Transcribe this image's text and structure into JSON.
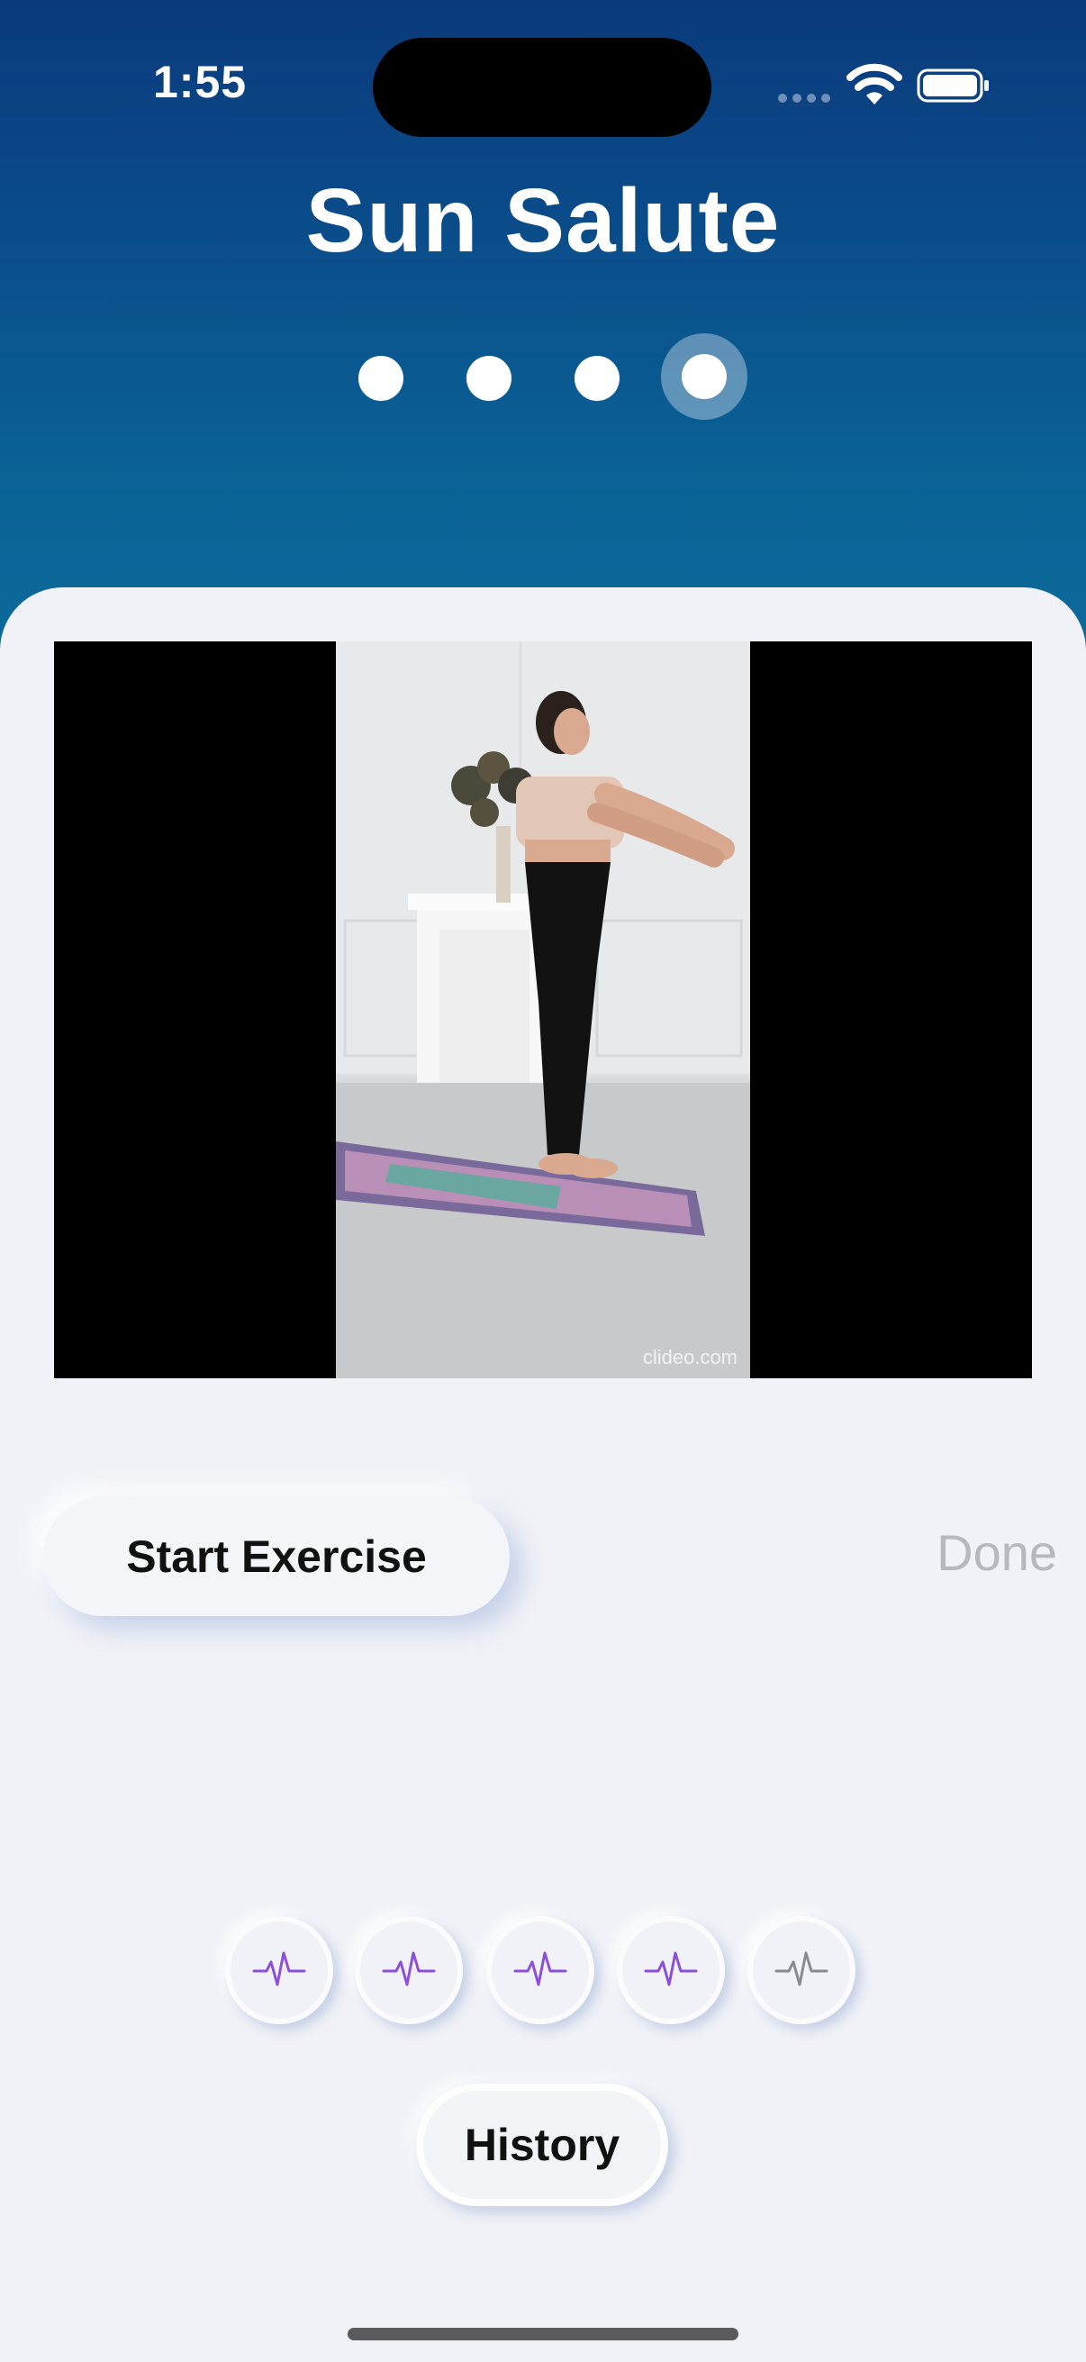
{
  "status_bar": {
    "time": "1:55"
  },
  "title": "Sun Salute",
  "page_indicator": {
    "count": 4,
    "active_index": 3
  },
  "video": {
    "watermark": "clideo.com"
  },
  "buttons": {
    "start": "Start Exercise",
    "done": "Done",
    "history": "History"
  },
  "history_indicators": [
    {
      "icon": "heartbeat-icon",
      "state": "completed",
      "color": "#8b4fd8"
    },
    {
      "icon": "heartbeat-icon",
      "state": "completed",
      "color": "#8b4fd8"
    },
    {
      "icon": "heartbeat-icon",
      "state": "completed",
      "color": "#8b4fd8"
    },
    {
      "icon": "heartbeat-icon",
      "state": "completed",
      "color": "#8b4fd8"
    },
    {
      "icon": "heartbeat-icon",
      "state": "pending",
      "color": "#8a8a8e"
    }
  ],
  "colors": {
    "header_top": "#0a3a7c",
    "header_bottom": "#0b6a9a",
    "background": "#f1f2f7",
    "done_disabled": "#b7b7bd"
  }
}
